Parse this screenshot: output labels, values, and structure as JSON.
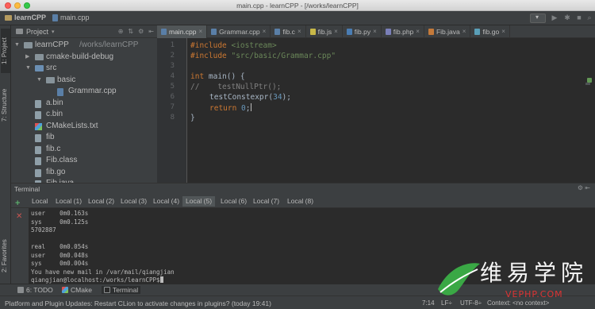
{
  "window": {
    "title": "main.cpp - learnCPP - [/works/learnCPP]"
  },
  "nav": {
    "project": "learnCPP",
    "file": "main.cpp"
  },
  "left_strip": {
    "project_tab": "1: Project",
    "structure_tab": "7: Structure",
    "favorites_tab": "2: Favorites"
  },
  "project_panel": {
    "header": "Project",
    "tree": [
      {
        "label": "learnCPP",
        "suffix": "/works/learnCPP",
        "type": "folder",
        "depth": 0,
        "expanded": true
      },
      {
        "label": "cmake-build-debug",
        "type": "folder",
        "depth": 1,
        "expanded": false
      },
      {
        "label": "src",
        "type": "folder",
        "depth": 1,
        "expanded": true
      },
      {
        "label": "basic",
        "type": "folder",
        "depth": 2,
        "expanded": true
      },
      {
        "label": "Grammar.cpp",
        "type": "cpp",
        "depth": 3
      },
      {
        "label": "a.bin",
        "type": "file",
        "depth": 1
      },
      {
        "label": "c.bin",
        "type": "file",
        "depth": 1
      },
      {
        "label": "CMakeLists.txt",
        "type": "cmake",
        "depth": 1
      },
      {
        "label": "fib",
        "type": "file",
        "depth": 1
      },
      {
        "label": "fib.c",
        "type": "file",
        "depth": 1
      },
      {
        "label": "Fib.class",
        "type": "file",
        "depth": 1
      },
      {
        "label": "fib.go",
        "type": "file",
        "depth": 1
      },
      {
        "label": "Fib.java",
        "type": "file",
        "depth": 1
      }
    ]
  },
  "editor": {
    "tabs": [
      {
        "label": "main.cpp",
        "active": true,
        "color": "#5a7fa7"
      },
      {
        "label": "Grammar.cpp",
        "active": false,
        "color": "#5a7fa7"
      },
      {
        "label": "fib.c",
        "active": false,
        "color": "#5a7fa7"
      },
      {
        "label": "fib.js",
        "active": false,
        "color": "#c8b848"
      },
      {
        "label": "fib.py",
        "active": false,
        "color": "#4a7db3"
      },
      {
        "label": "fib.php",
        "active": false,
        "color": "#7a7fb8"
      },
      {
        "label": "Fib.java",
        "active": false,
        "color": "#c47a3a"
      },
      {
        "label": "fib.go",
        "active": false,
        "color": "#5a9fb8"
      }
    ],
    "line_numbers": [
      "1",
      "2",
      "3",
      "4",
      "5",
      "6",
      "7",
      "8"
    ],
    "code": {
      "l1_directive": "#include",
      "l1_header": " <iostream>",
      "l2_directive": "#include",
      "l2_header": " \"src/basic/Grammar.cpp\"",
      "l4_kw": "int",
      "l4_rest": " main() {",
      "l5_comment": "//    testNullPtr();",
      "l6_call": "testConstexpr",
      "l6_open": "(",
      "l6_arg": "34",
      "l6_close": ");",
      "l7_kw": "return",
      "l7_num": " 0",
      "l7_semi": ";",
      "l8": "}"
    }
  },
  "terminal": {
    "title": "Terminal",
    "tabs": [
      "Local",
      "Local (1)",
      "Local (2)",
      "Local (3)",
      "Local (4)",
      "Local (5)",
      "Local (6)",
      "Local (7)",
      "Local (8)"
    ],
    "active_tab": "Local (5)",
    "lines": [
      "user    0m0.163s",
      "sys     0m0.125s",
      "5702887",
      "",
      "real    0m0.054s",
      "user    0m0.048s",
      "sys     0m0.004s",
      "You have new mail in /var/mail/qiangjian"
    ],
    "prompt": "qiangjian@localhost:/works/learnCPP$"
  },
  "tool_windows": {
    "todo": "6: TODO",
    "cmake": "CMake",
    "terminal": "Terminal"
  },
  "status": {
    "message": "Platform and Plugin Updates: Restart CLion to activate changes in plugins? (today 19:41)",
    "position": "7:14",
    "line_sep": "LF÷",
    "encoding": "UTF-8÷",
    "context": "Context: <no context>"
  },
  "watermark": {
    "text": "维易学院",
    "url": "VEPHP.COM"
  },
  "colors": {
    "accent": "#cc7832",
    "string": "#6a8759",
    "number": "#6897bb",
    "function": "#ffc66d"
  }
}
